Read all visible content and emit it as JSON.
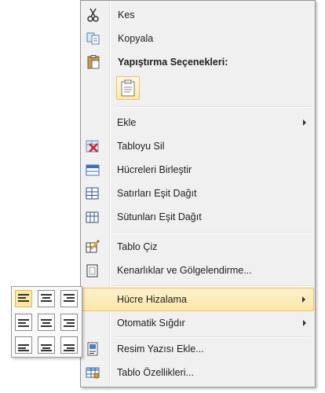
{
  "menu": {
    "cut": "Kes",
    "copy": "Kopyala",
    "paste_options_header": "Yapıştırma Seçenekleri:",
    "insert": "Ekle",
    "delete_table": "Tabloyu Sil",
    "merge_cells": "Hücreleri Birleştir",
    "distribute_rows": "Satırları Eşit Dağıt",
    "distribute_columns": "Sütunları Eşit Dağıt",
    "draw_table": "Tablo Çiz",
    "borders_shading": "Kenarlıklar ve Gölgelendirme...",
    "cell_alignment": "Hücre Hizalama",
    "autofit": "Otomatik Sığdır",
    "insert_caption": "Resim Yazısı Ekle...",
    "table_properties": "Tablo Özellikleri..."
  },
  "alignment_grid": {
    "rows": [
      [
        "top-left",
        "top-center",
        "top-right"
      ],
      [
        "middle-left",
        "middle-center",
        "middle-right"
      ],
      [
        "bottom-left",
        "bottom-center",
        "bottom-right"
      ]
    ],
    "selected": "top-left"
  },
  "colors": {
    "menu_bg": "#f0f0f0",
    "highlight": "#fde7a8",
    "highlight_border": "#f1c453"
  }
}
